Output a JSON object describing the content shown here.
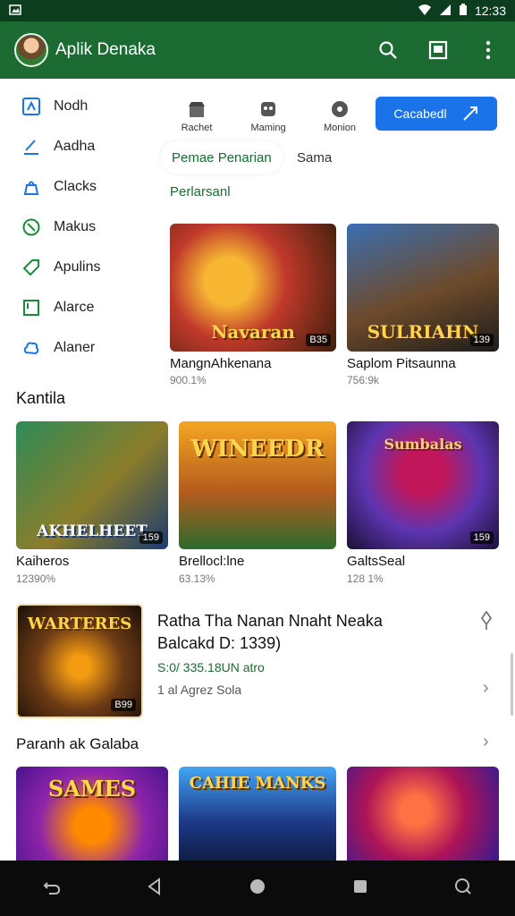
{
  "status": {
    "time": "12:33"
  },
  "app": {
    "title": "Aplik Denaka"
  },
  "sidebar": {
    "items": [
      {
        "label": "Nodh",
        "color": "#1a73e8"
      },
      {
        "label": "Aadha",
        "color": "#1a73e8"
      },
      {
        "label": "Clacks",
        "color": "#1a73e8"
      },
      {
        "label": "Makus",
        "color": "#1b8a3c"
      },
      {
        "label": "Apulins",
        "color": "#1b8a3c"
      },
      {
        "label": "Alarce",
        "color": "#1b8a3c"
      },
      {
        "label": "Alaner",
        "color": "#1a73e8"
      }
    ]
  },
  "topnav": {
    "items": [
      {
        "label": "Rachet",
        "icon": "store-icon"
      },
      {
        "label": "Maming",
        "icon": "gamepad-icon"
      },
      {
        "label": "Monion",
        "icon": "circle-icon"
      }
    ],
    "cta_label": "Cacabedl"
  },
  "chips": {
    "active": "Pemae Penarian",
    "second": "Sama",
    "third": "Perlarsanl"
  },
  "featured_row": [
    {
      "title": "MangnAhkenana",
      "sub": "900.1%",
      "badge": "B35",
      "logo": "Navaran",
      "colors": [
        "#f7b733",
        "#c0392b",
        "#3b1f0a"
      ]
    },
    {
      "title": "Saplom Pitsaunna",
      "sub": "756:9k",
      "badge": "139",
      "logo": "SULRIAHN",
      "colors": [
        "#3a6fb0",
        "#6d4a2a",
        "#1c1c1c"
      ]
    }
  ],
  "sections": {
    "kantila": "Kantila",
    "paranh": "Paranh ak Galaba"
  },
  "grid_row": [
    {
      "title": "Kaiheros",
      "sub": "12390%",
      "badge": "159",
      "logo": "AKHELHEET",
      "colors": [
        "#2e8b57",
        "#8b7d2a",
        "#1b3b6f"
      ]
    },
    {
      "title": "Brellocl:lne",
      "sub": "63.13%",
      "badge": "",
      "logo": "WINEEDR",
      "colors": [
        "#f5a623",
        "#b45c1e",
        "#2d6a2e"
      ]
    },
    {
      "title": "GaltsSeal",
      "sub": "128 1%",
      "badge": "159",
      "logo": "Sumbalas",
      "colors": [
        "#5e35b1",
        "#c2185b",
        "#1a1033"
      ]
    }
  ],
  "feature": {
    "title": "Ratha Tha Nanan Nnaht Neaka Balcakd D: 1339)",
    "green": "S:0/ 335.18UN atro",
    "gray": "1 al Agrez Sola",
    "badge": "B99",
    "logo": "WARTERES"
  },
  "bottom_row": [
    {
      "logo": "SAMES",
      "colors": [
        "#ff8a00",
        "#8e24aa",
        "#4a148c"
      ]
    },
    {
      "logo": "CAHIE MANKS",
      "colors": [
        "#42a5f5",
        "#1e3a8a",
        "#0d1b3d"
      ]
    },
    {
      "logo": "",
      "colors": [
        "#ff7043",
        "#ad1457",
        "#311b92"
      ]
    }
  ]
}
